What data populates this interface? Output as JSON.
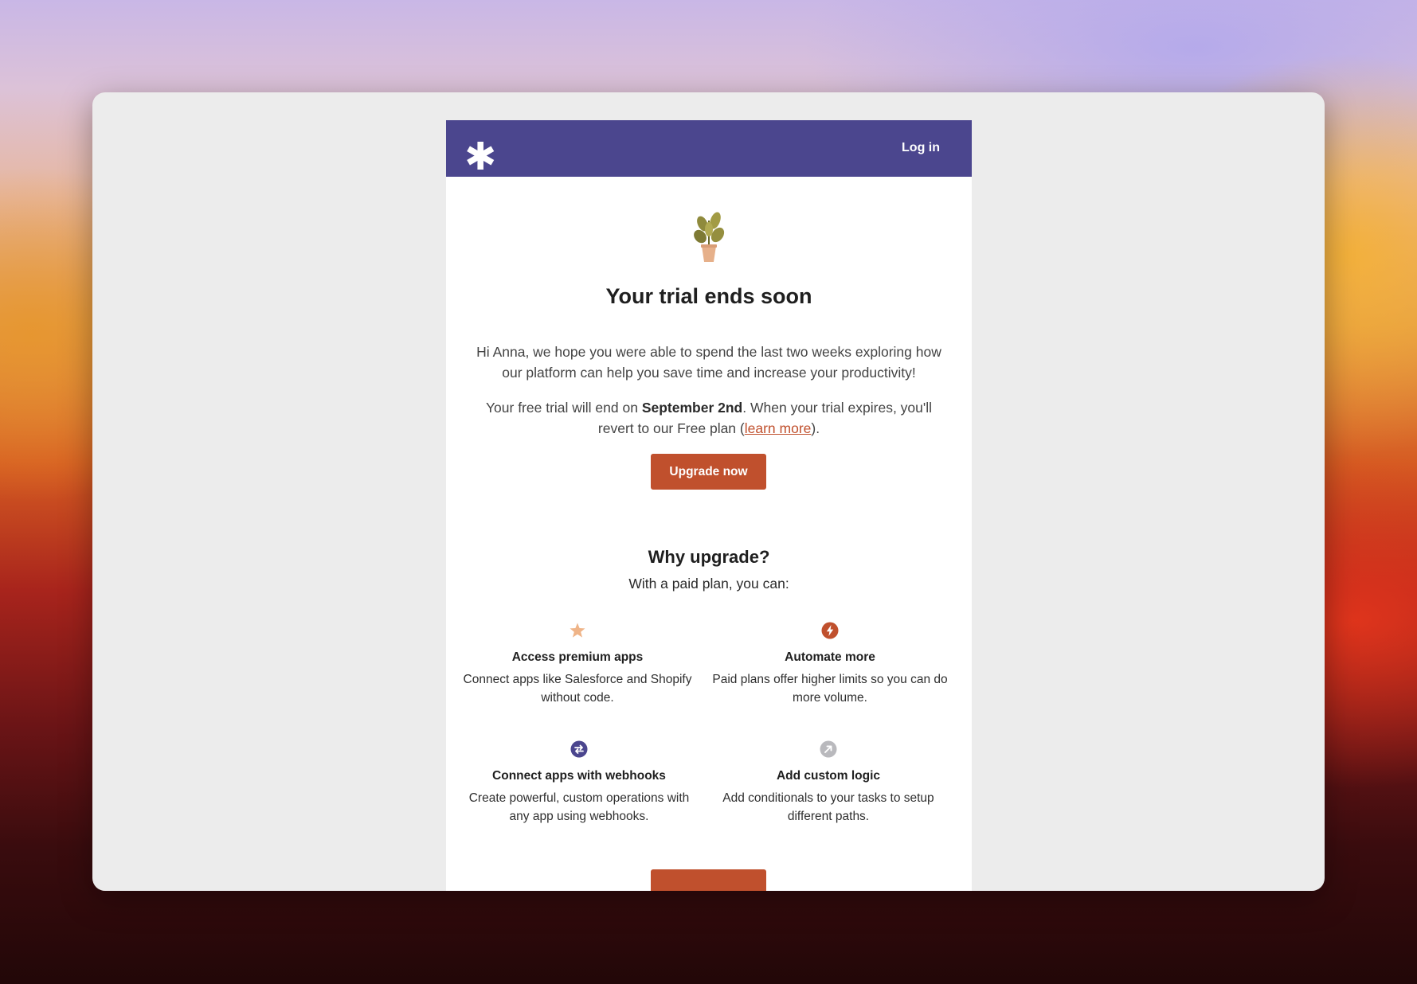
{
  "header": {
    "logo_icon": "asterisk-logo-icon",
    "login_label": "Log in",
    "brand_color": "#4b468e"
  },
  "hero": {
    "icon": "potted-plant-icon",
    "title": "Your trial ends soon",
    "intro": "Hi Anna, we hope you were able to spend the last two weeks exploring how our platform can help you save time and increase your productivity!",
    "trial_prefix": "Your free trial will end on ",
    "trial_date": "September 2nd",
    "trial_mid": ". When your trial expires, you'll revert to our Free plan (",
    "learn_more": "learn more",
    "trial_suffix": ").",
    "cta_label": "Upgrade now",
    "accent_color": "#c0502d"
  },
  "why": {
    "title": "Why upgrade?",
    "subtitle": "With a paid plan, you can:",
    "features": [
      {
        "icon": "star-icon",
        "title": "Access premium apps",
        "desc": "Connect apps like Salesforce and Shopify without code."
      },
      {
        "icon": "lightning-icon",
        "title": "Automate more",
        "desc": "Paid plans offer higher limits so you can do more volume."
      },
      {
        "icon": "swap-arrows-icon",
        "title": "Connect apps with webhooks",
        "desc": "Create powerful, custom operations with any app using webhooks."
      },
      {
        "icon": "diagonal-arrow-icon",
        "title": "Add custom logic",
        "desc": "Add conditionals to your tasks to setup different paths."
      }
    ]
  }
}
